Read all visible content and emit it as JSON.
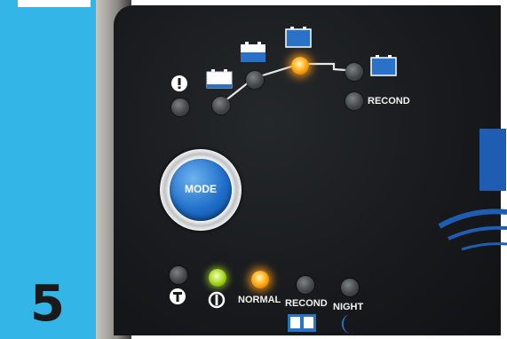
{
  "step": {
    "number": "5"
  },
  "panel": {
    "button": {
      "label": "MODE"
    },
    "top_leds": {
      "recond_label": "RECOND"
    },
    "bottom_leds": {
      "normal_label": "NORMAL",
      "recond_label": "RECOND",
      "night_label": "NIGHT"
    }
  },
  "colors": {
    "sidebar": "#33b5e8",
    "led_active_orange": "#ffb21c",
    "led_active_green": "#a8d820",
    "mode_button": "#1f6ec9",
    "brand_blue": "#1f5db3"
  }
}
